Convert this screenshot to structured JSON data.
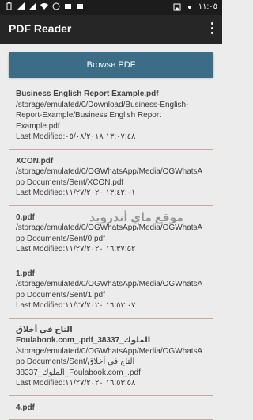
{
  "status_bar": {
    "time": "١١:٠٥",
    "left_icons": [
      "battery-icon",
      "signal-icon",
      "signal-icon",
      "wifi-icon",
      "whatsapp-icon",
      "chat-icon",
      "chat-icon"
    ],
    "right_icons": [
      "image-icon",
      "dot-icon"
    ]
  },
  "app_bar": {
    "title": "PDF Reader",
    "overflow_icon": "more-vert-icon"
  },
  "browse_button": {
    "label": "Browse PDF"
  },
  "watermark": {
    "text": "موقع ماي أندرويد"
  },
  "files": [
    {
      "name": "Business English Report Example.pdf",
      "path": "/storage/emulated/0/Download/Business-English-Report-Example/Business English Report Example.pdf",
      "modified": "Last Modified:١٣:٠٧:٤٨ ٠٥/٠٨/٢٠١٨"
    },
    {
      "name": "XCON.pdf",
      "path": "/storage/emulated/0/OGWhatsApp/Media/OGWhatsApp Documents/Sent/XCON.pdf",
      "modified": "Last Modified:١٣:٤٢:٠١ ١١/٢٧/٢٠٢٠"
    },
    {
      "name": "0.pdf",
      "path": "/storage/emulated/0/OGWhatsApp/Media/OGWhatsApp Documents/Sent/0.pdf",
      "modified": "Last Modified:١٦:٣٧:٥٢ ١١/٢٧/٢٠٢٠"
    },
    {
      "name": "1.pdf",
      "path": "/storage/emulated/0/OGWhatsApp/Media/OGWhatsApp Documents/Sent/1.pdf",
      "modified": "Last Modified:١٦:٥٣:٠٧ ١١/٢٧/٢٠٢٠"
    },
    {
      "name": "التاج في أخلاق الملوك_38337_Foulabook.com_.pdf",
      "path": "/storage/emulated/0/OGWhatsApp/Media/OGWhatsApp Documents/Sent/التاج في أخلاق الملوك_38337_Foulabook.com_.pdf",
      "modified": "Last Modified:١٦:٥٣:٥٨ ١١/٢٧/٢٠٢٠"
    },
    {
      "name": "4.pdf",
      "path": "",
      "modified": ""
    }
  ]
}
